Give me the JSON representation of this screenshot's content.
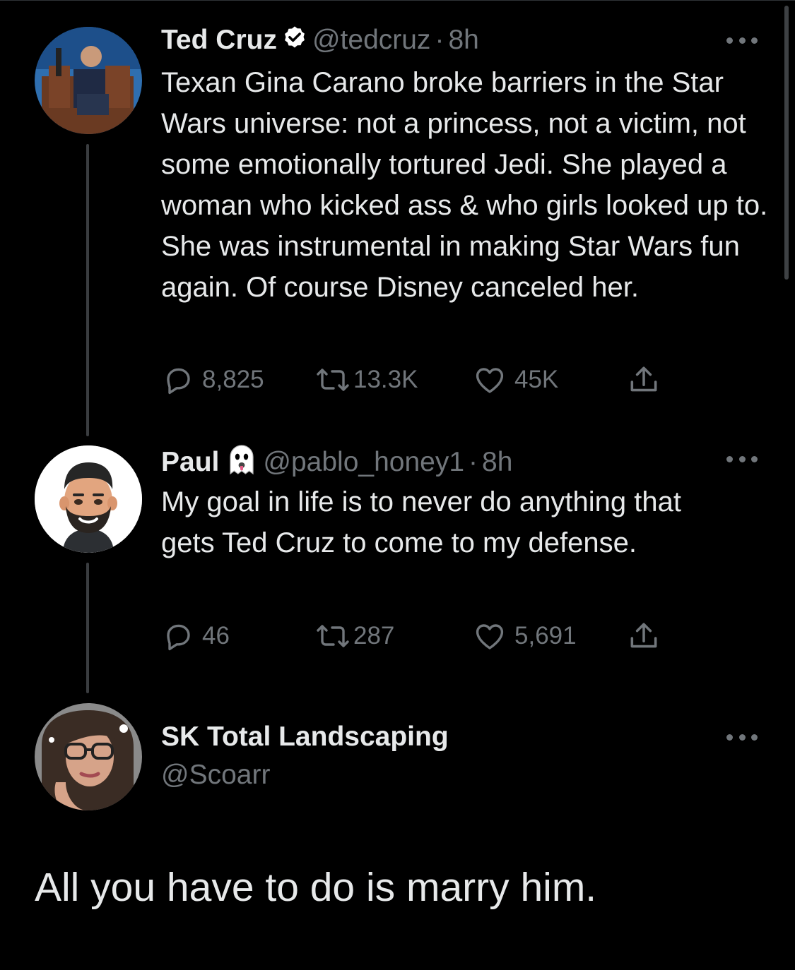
{
  "tweets": [
    {
      "name": "Ted Cruz",
      "handle": "@tedcruz",
      "sep": "·",
      "time": "8h",
      "verified": true,
      "text": "Texan Gina Carano broke barriers in the Star Wars universe: not a princess, not a victim, not some emotionally tortured Jedi. She played a woman who kicked ass & who girls looked up to. She was instrumental in making Star Wars fun again. Of course Disney canceled her.",
      "replies": "8,825",
      "retweets": "13.3K",
      "likes": "45K"
    },
    {
      "name": "Paul",
      "badge_icon": "ghost-emoji",
      "handle": "@pablo_honey1",
      "sep": "·",
      "time": "8h",
      "text": "My goal in life is to never do anything that gets Ted Cruz to come to my defense.",
      "replies": "46",
      "retweets": "287",
      "likes": "5,691"
    },
    {
      "name": "SK Total Landscaping",
      "handle": "@Scoarr",
      "text": "All you have to do is marry him."
    }
  ],
  "colors": {
    "background": "#000000",
    "primary_text": "#e7e9ea",
    "secondary_text": "#71767b",
    "thread_line": "#3a3d40",
    "verified": "#ffffff"
  }
}
